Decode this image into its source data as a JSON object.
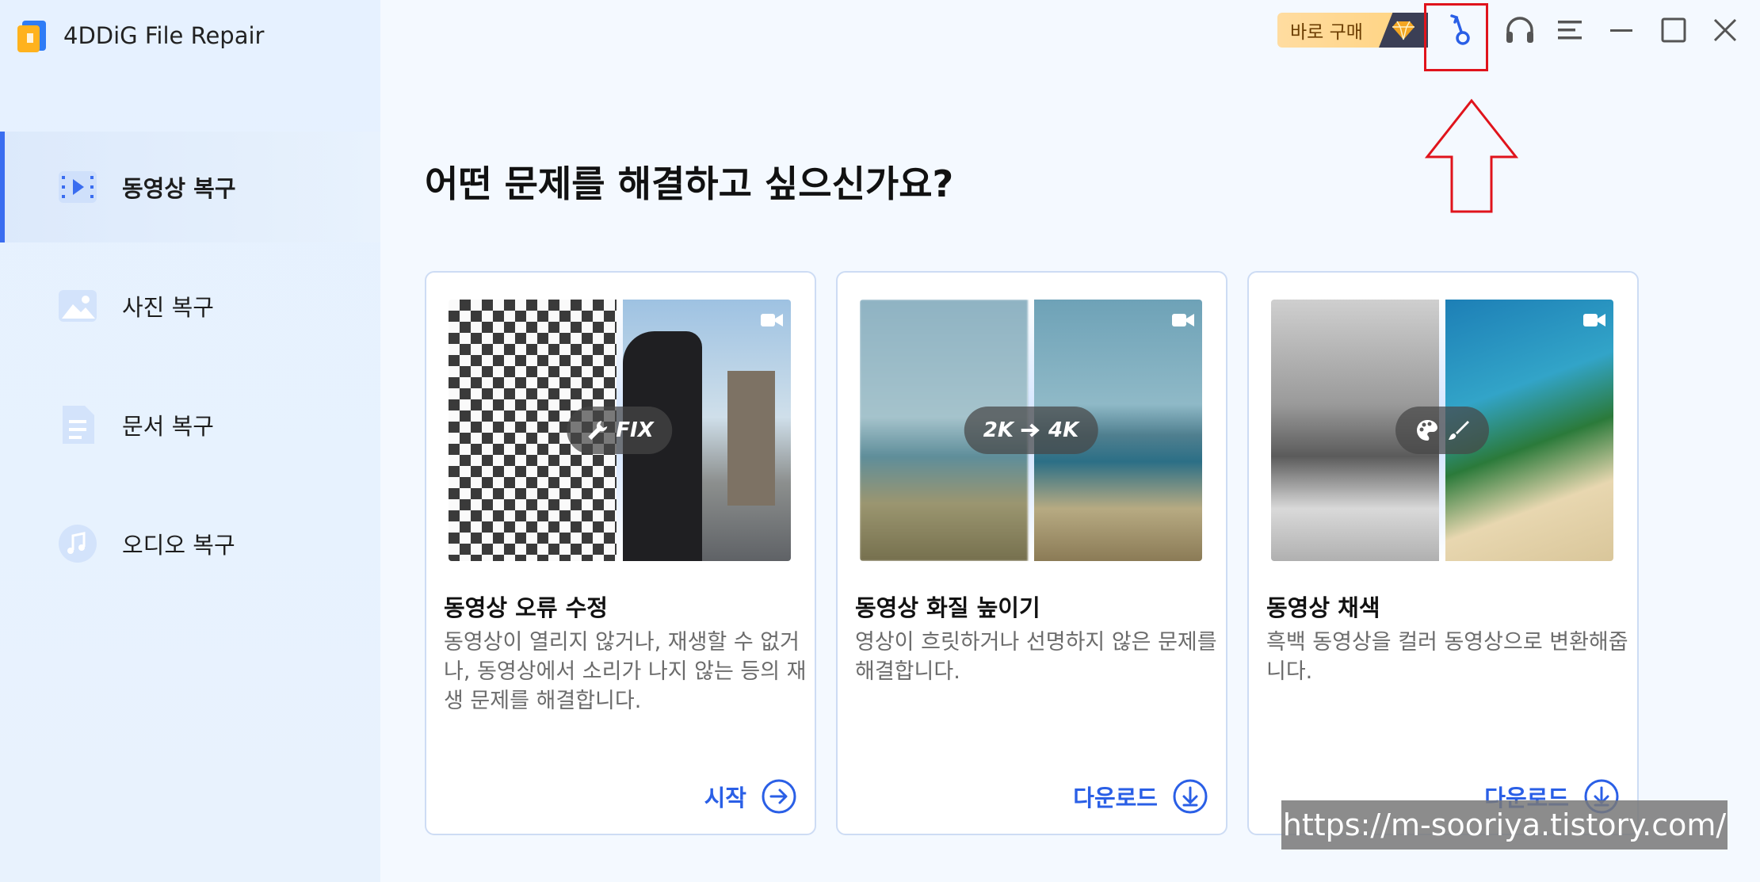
{
  "app": {
    "title": "4DDiG File Repair"
  },
  "sidebar": {
    "items": [
      {
        "label": "동영상 복구",
        "icon": "video-repair-icon",
        "active": true
      },
      {
        "label": "사진 복구",
        "icon": "photo-repair-icon",
        "active": false
      },
      {
        "label": "문서 복구",
        "icon": "document-repair-icon",
        "active": false
      },
      {
        "label": "오디오 복구",
        "icon": "audio-repair-icon",
        "active": false
      }
    ]
  },
  "topbar": {
    "buy_label": "바로 구매",
    "icons": [
      "diamond-icon",
      "key-icon",
      "headset-icon",
      "menu-icon",
      "minimize-icon",
      "maximize-icon",
      "close-icon"
    ]
  },
  "main": {
    "headline": "어떤 문제를 해결하고 싶으신가요?",
    "cards": [
      {
        "media_label": "FIX",
        "title": "동영상 오류 수정",
        "description": "동영상이 열리지 않거나, 재생할 수 없거나, 동영상에서 소리가 나지 않는 등의 재생 문제를 해결합니다.",
        "action": "시작"
      },
      {
        "media_label_left": "2K",
        "media_label_right": "4K",
        "title": "동영상 화질 높이기",
        "description": "영상이 흐릿하거나 선명하지 않은 문제를 해결합니다.",
        "action": "다운로드"
      },
      {
        "title": "동영상 채색",
        "description": "흑백 동영상을 컬러 동영상으로 변환해줍니다.",
        "action": "다운로드"
      }
    ]
  },
  "watermark": "https://m-sooriya.tistory.com/",
  "colors": {
    "accent": "#2a5fe6",
    "highlight": "#e0141c",
    "buy_badge": "#ffd37e"
  }
}
